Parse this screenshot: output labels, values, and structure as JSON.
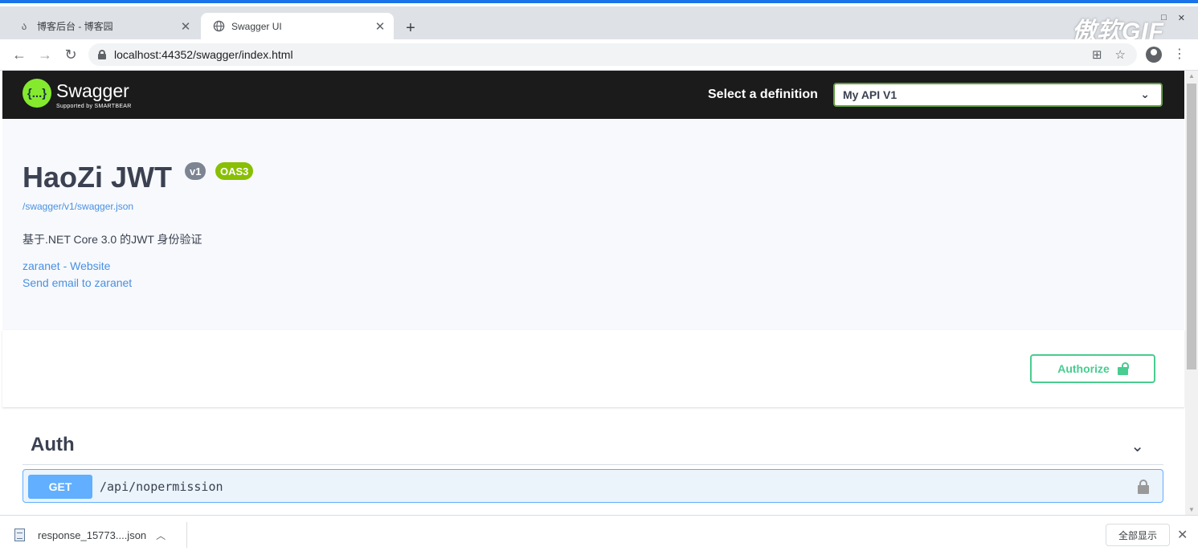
{
  "browser": {
    "tabs": [
      {
        "title": "博客后台 - 博客园",
        "active": false,
        "favicon": "cnblogs-icon"
      },
      {
        "title": "Swagger UI",
        "active": true,
        "favicon": "globe-icon"
      }
    ],
    "url": "localhost:44352/swagger/index.html",
    "watermark": "傲软GIF",
    "accent_color": "#1a73e8"
  },
  "topbar": {
    "logo_symbol": "{...}",
    "brand": "Swagger",
    "brand_sub": "Supported by SMARTBEAR",
    "select_label": "Select a definition",
    "selected_definition": "My API V1"
  },
  "info": {
    "title": "HaoZi JWT",
    "version_badge": "v1",
    "oas_badge": "OAS3",
    "spec_url": "/swagger/v1/swagger.json",
    "description": "基于.NET Core 3.0 的JWT 身份验证",
    "contact_website": "zaranet - Website",
    "contact_email": "Send email to zaranet"
  },
  "scheme": {
    "authorize_label": "Authorize",
    "authorize_color": "#49cc90"
  },
  "operations": {
    "tag": "Auth",
    "items": [
      {
        "method": "GET",
        "path": "/api/nopermission",
        "method_color": "#61affe"
      }
    ]
  },
  "downloads": {
    "file_name": "response_15773....json",
    "show_all_label": "全部显示"
  }
}
